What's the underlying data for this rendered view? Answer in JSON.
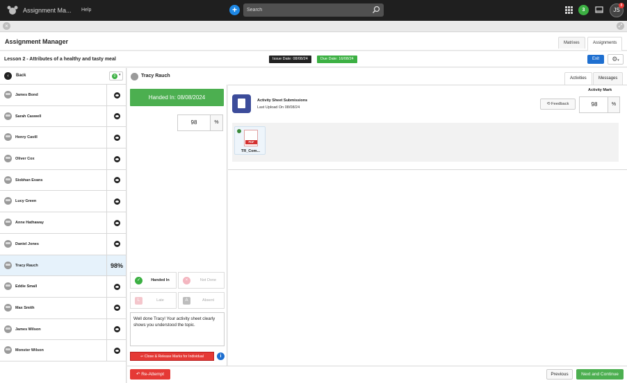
{
  "topbar": {
    "app_title": "Assignment Ma...",
    "help_label": "Help",
    "search_placeholder": "Search",
    "notification_count": "3",
    "user_initials": "JS",
    "user_badge": "8"
  },
  "header": {
    "title": "Assignment Manager",
    "tabs": [
      {
        "label": "Matrixes"
      },
      {
        "label": "Assignments"
      }
    ]
  },
  "lesson": {
    "title": "Lesson 2 - Attributes of a healthy and tasty meal",
    "issue_date": "Issue Date: 08/08/24",
    "due_date": "Due Date: 16/08/24",
    "exit_label": "Exit"
  },
  "sidebar": {
    "back_label": "Back",
    "filter_count": "0",
    "students": [
      {
        "name": "James Bond",
        "mark": ""
      },
      {
        "name": "Sarah Caswell",
        "mark": ""
      },
      {
        "name": "Henry Cavill",
        "mark": ""
      },
      {
        "name": "Oliver Cox",
        "mark": ""
      },
      {
        "name": "Siobhan Evans",
        "mark": ""
      },
      {
        "name": "Lucy Green",
        "mark": ""
      },
      {
        "name": "Anne Hathaway",
        "mark": ""
      },
      {
        "name": "Daniel Jones",
        "mark": ""
      },
      {
        "name": "Tracy Rauch",
        "mark": "98%"
      },
      {
        "name": "Eddie Small",
        "mark": ""
      },
      {
        "name": "Max Smith",
        "mark": ""
      },
      {
        "name": "James Wilson",
        "mark": ""
      },
      {
        "name": "Monster Wilson",
        "mark": ""
      }
    ]
  },
  "student_panel": {
    "name": "Tracy Rauch",
    "handed_in_banner": "Handed In: 08/08/2024",
    "mark_value": "98",
    "mark_unit": "%",
    "statuses": {
      "handed_in": "Handed In",
      "not_done": "Not Done",
      "late": "Late",
      "absent": "Absent"
    },
    "status_icons": {
      "handed_in": "✓",
      "not_done": "×",
      "late": "L",
      "absent": "A"
    },
    "feedback_text": "Well done Tracy! Your activity sheet clearly shows you understood the topic.",
    "release_label": "↩ Close & Release Marks for Individual"
  },
  "activities": {
    "tabs": [
      {
        "label": "Activities"
      },
      {
        "label": "Messages"
      }
    ],
    "title": "Activity Sheet Submissions",
    "last_upload": "Last Upload On 08/08/24",
    "activity_mark_label": "Activity Mark",
    "feedback_label": "Feedback",
    "mark_value": "98",
    "mark_unit": "%",
    "file": {
      "name": "TR_Com...",
      "type_label": "PDF"
    }
  },
  "footer": {
    "reattempt_label": "↶ Re-Attempt",
    "previous_label": "Previous",
    "next_label": "Next and Continue"
  },
  "colors": {
    "accent_blue": "#1e6fd0",
    "success_green": "#4caf50",
    "danger_red": "#e53935"
  }
}
